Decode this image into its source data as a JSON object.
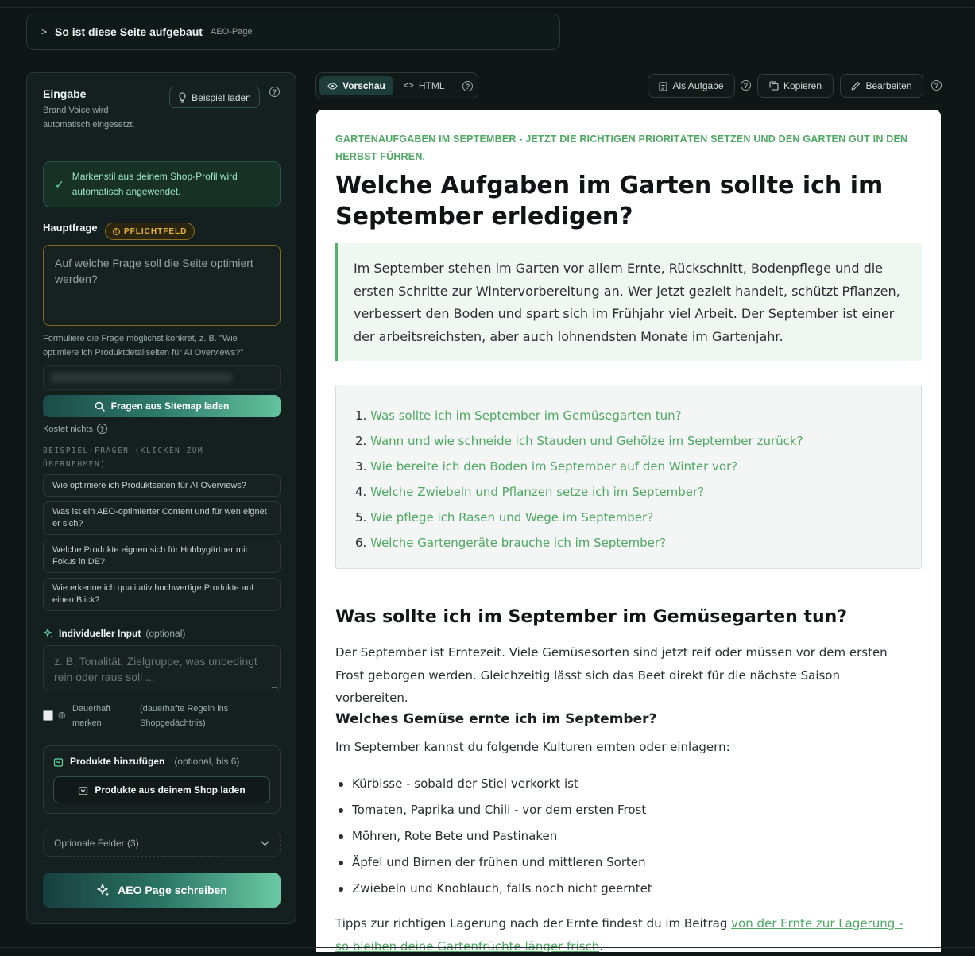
{
  "structure": {
    "title": "So ist diese Seite aufgebaut",
    "tag": "AEO-Page"
  },
  "input_panel": {
    "title": "Eingabe",
    "subtitle": "Brand Voice wird automatisch eingesetzt.",
    "example_button": "Beispiel laden",
    "notice": "Markenstil aus deinem Shop-Profil wird automatisch angewendet.",
    "main_question_label": "Hauptfrage",
    "required_badge": "PFLICHTFELD",
    "main_question_placeholder": "Auf welche Frage soll die Seite optimiert werden?",
    "hint": "Formuliere die Frage möglichst konkret, z. B. \"Wie optimiere ich Produktdetailseiten für AI Overviews?\"",
    "sitemap_button": "Fragen aus Sitemap laden",
    "cost_label": "Kostet nichts",
    "examples_label": "BEISPIEL-FRAGEN (KLICKEN ZUM ÜBERNEHMEN)",
    "examples": [
      "Wie optimiere ich Produktseiten für AI Overviews?",
      "Was ist ein AEO-optimierter Content und für wen eignet er sich?",
      "Welche Produkte eignen sich für Hobbygärtner mir Fokus in DE?",
      "Wie erkenne ich qualitativ hochwertige Produkte auf einen Blick?"
    ],
    "individual_label": "Individueller Input",
    "individual_optional": "(optional)",
    "individual_placeholder": "z. B. Tonalität, Zielgruppe, was unbedingt rein oder raus soll ...",
    "remember_label": "Dauerhaft merken",
    "remember_note": "(dauerhafte Regeln ins Shopgedächtnis)",
    "products_label": "Produkte hinzufügen",
    "products_optional": "(optional, bis 6)",
    "products_button": "Produkte aus deinem Shop laden",
    "optional_fields": "Optionale Felder (3)",
    "write_button": "AEO Page schreiben"
  },
  "toolbar": {
    "preview_tab": "Vorschau",
    "html_tab": "HTML",
    "task_button": "Als Aufgabe",
    "copy_button": "Kopieren",
    "edit_button": "Bearbeiten"
  },
  "article": {
    "kicker": "Gartenaufgaben im September - jetzt die richtigen Prioritäten setzen und den Garten gut in den Herbst führen.",
    "title": "Welche Aufgaben im Garten sollte ich im September erledigen?",
    "summary": "Im September stehen im Garten vor allem Ernte, Rückschnitt, Bodenpflege und die ersten Schritte zur Wintervorbereitung an. Wer jetzt gezielt handelt, schützt Pflanzen, verbessert den Boden und spart sich im Frühjahr viel Arbeit. Der September ist einer der arbeitsreichsten, aber auch lohnendsten Monate im Gartenjahr.",
    "toc": [
      {
        "num": "1.",
        "text": "Was sollte ich im September im Gemüsegarten tun?"
      },
      {
        "num": "2.",
        "text": "Wann und wie schneide ich Stauden und Gehölze im September zurück?"
      },
      {
        "num": "3.",
        "text": "Wie bereite ich den Boden im September auf den Winter vor?"
      },
      {
        "num": "4.",
        "text": "Welche Zwiebeln und Pflanzen setze ich im September?"
      },
      {
        "num": "5.",
        "text": "Wie pflege ich Rasen und Wege im September?"
      },
      {
        "num": "6.",
        "text": "Welche Gartengeräte brauche ich im September?"
      }
    ],
    "section1_title": "Was sollte ich im September im Gemüsegarten tun?",
    "section1_text": "Der September ist Erntezeit. Viele Gemüsesorten sind jetzt reif oder müssen vor dem ersten Frost geborgen werden. Gleichzeitig lässt sich das Beet direkt für die nächste Saison vorbereiten.",
    "sub1_title": "Welches Gemüse ernte ich im September?",
    "sub1_intro": "Im September kannst du folgende Kulturen ernten oder einlagern:",
    "sub1_list": [
      "Kürbisse - sobald der Stiel verkorkt ist",
      "Tomaten, Paprika und Chili - vor dem ersten Frost",
      "Möhren, Rote Bete und Pastinaken",
      "Äpfel und Birnen der frühen und mittleren Sorten",
      "Zwiebeln und Knoblauch, falls noch nicht geerntet"
    ],
    "tip_prefix": "Tipps zur richtigen Lagerung nach der Ernte findest du im Beitrag ",
    "tip_link": "von der Ernte zur Lagerung - so bleiben deine Gartenfrüchte länger frisch",
    "tip_suffix": "."
  }
}
